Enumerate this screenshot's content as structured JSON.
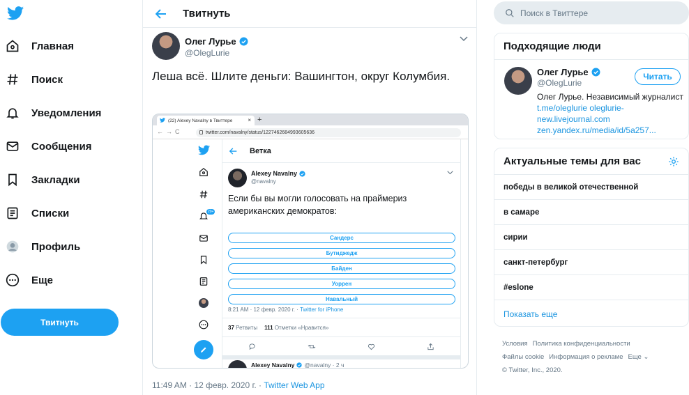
{
  "sidebar": {
    "items": [
      {
        "label": "Главная",
        "icon": "home-icon"
      },
      {
        "label": "Поиск",
        "icon": "hashtag-icon"
      },
      {
        "label": "Уведомления",
        "icon": "bell-icon"
      },
      {
        "label": "Сообщения",
        "icon": "envelope-icon"
      },
      {
        "label": "Закладки",
        "icon": "bookmark-icon"
      },
      {
        "label": "Списки",
        "icon": "list-icon"
      },
      {
        "label": "Профиль",
        "icon": "profile-icon"
      },
      {
        "label": "Еще",
        "icon": "more-icon"
      }
    ],
    "tweet_button": "Твитнуть"
  },
  "header": {
    "title": "Твитнуть"
  },
  "tweet": {
    "author_name": "Олег Лурье",
    "author_handle": "@OlegLurie",
    "text": "Леша всё. Шлите деньги: Вашингтон, округ Колумбия.",
    "timestamp": "11:49 AM · 12 февр. 2020 г. · ",
    "source": "Twitter Web App"
  },
  "embedded": {
    "tab_title": "(22) Alexey Navalny в Твиттере",
    "url": "twitter.com/navalny/status/1227462684993605636",
    "header_title": "Ветка",
    "notifications_badge": "20+",
    "author_name": "Alexey Navalny",
    "author_handle": "@navalny",
    "text": "Если бы вы могли голосовать на праймериз американских демократов:",
    "poll": [
      "Сандерс",
      "Бутиджедж",
      "Байден",
      "Уоррен",
      "Навальный"
    ],
    "meta": "8:21 AM · 12 февр. 2020 г. · ",
    "meta_source": "Twitter for iPhone",
    "retweets_count": "37",
    "retweets_label": "Ретвиты",
    "likes_count": "111",
    "likes_label": "Отметки «Нравится»",
    "next_name": "Alexey Navalny",
    "next_handle": "@navalny · 2 ч"
  },
  "search": {
    "placeholder": "Поиск в Твиттере"
  },
  "who_to_follow": {
    "title": "Подходящие люди",
    "name": "Олег Лурье",
    "handle": "@OlegLurie",
    "follow_label": "Читать",
    "bio_text": "Олег Лурье. Независимый журналист ",
    "bio_links": "t.me/oleglurie oleglurie-new.livejournal.com zen.yandex.ru/media/id/5a257..."
  },
  "trends": {
    "title": "Актуальные темы для вас",
    "items": [
      "победы в великой отечественной",
      "в самаре",
      "сирии",
      "санкт-петербург",
      "#eslone"
    ],
    "show_more": "Показать еще"
  },
  "footer": {
    "links_row1": [
      "Условия",
      "Политика конфиденциальности"
    ],
    "links_row2": [
      "Файлы cookie",
      "Информация о рекламе",
      "Еще"
    ],
    "copyright": "© Twitter, Inc., 2020."
  },
  "colors": {
    "accent": "#1da1f2",
    "link": "#1b95e0",
    "muted": "#657786"
  }
}
